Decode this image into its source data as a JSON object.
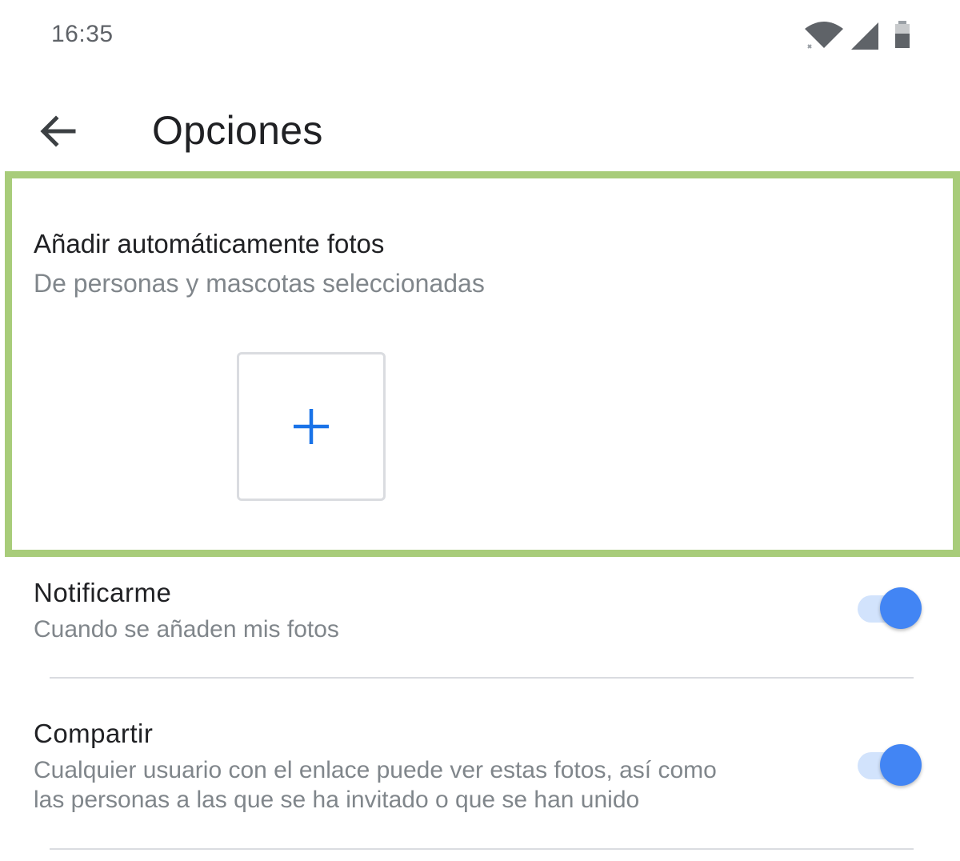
{
  "status_bar": {
    "time": "16:35",
    "icons": [
      "wifi-icon",
      "cell-signal-icon",
      "battery-icon"
    ]
  },
  "app_bar": {
    "back_icon": "arrow-back-icon",
    "title": "Opciones"
  },
  "auto_add": {
    "title": "Añadir automáticamente fotos",
    "subtitle": "De personas y mascotas seleccionadas",
    "add_icon": "plus-icon",
    "highlight_color": "#a8cc7a"
  },
  "settings": [
    {
      "title": "Notificarme",
      "description": "Cuando se añaden mis fotos",
      "enabled": true
    },
    {
      "title": "Compartir",
      "description": "Cualquier usuario con el enlace puede ver estas fotos, así como las personas a las que se ha invitado o que se han unido",
      "enabled": true
    }
  ],
  "colors": {
    "accent": "#4285f4",
    "toggle_track_on": "#d2e3fc",
    "secondary_text": "#80868b",
    "divider": "#dadce0"
  }
}
